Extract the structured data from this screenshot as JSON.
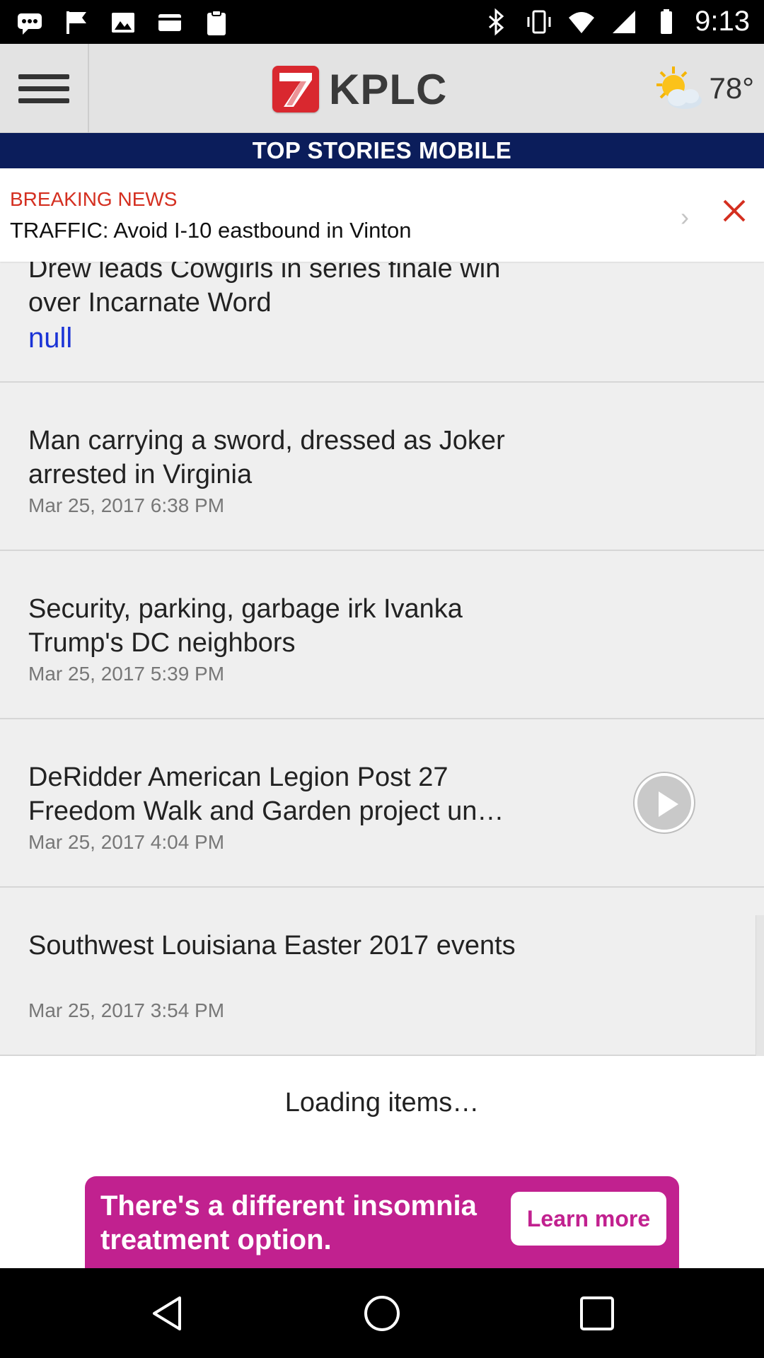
{
  "status_bar": {
    "time": "9:13",
    "left_icons": [
      "chat-icon",
      "flag-icon",
      "image-icon",
      "card-icon",
      "clipboard-icon"
    ],
    "right_icons": [
      "bluetooth-icon",
      "vibrate-icon",
      "wifi-icon",
      "signal-icon",
      "battery-icon"
    ]
  },
  "header": {
    "logo_number": "7",
    "logo_text": "KPLC",
    "weather_icon": "partly-sunny-icon",
    "temperature": "78°"
  },
  "section_title": "TOP STORIES MOBILE",
  "breaking": {
    "label": "BREAKING NEWS",
    "message": "TRAFFIC: Avoid I-10 eastbound in Vinton"
  },
  "stories": [
    {
      "headline": "Drew leads Cowgirls in series finale win over Incarnate Word",
      "date": "null",
      "date_color": "#1a33d6"
    },
    {
      "headline": "Man carrying a sword, dressed as Joker arrested in Virginia",
      "date": "Mar 25, 2017 6:38 PM"
    },
    {
      "headline": "Security, parking, garbage irk Ivanka Trump's DC neighbors",
      "date": "Mar 25, 2017 5:39 PM"
    },
    {
      "headline": "DeRidder American Legion Post 27 Freedom Walk and Garden project un…",
      "date": "Mar 25, 2017 4:04 PM",
      "has_video": true
    },
    {
      "headline": "Southwest Louisiana Easter 2017 events",
      "date": "Mar 25, 2017 3:54 PM"
    }
  ],
  "loading_text": "Loading items…",
  "ad": {
    "text": "There's a different insomnia treatment option.",
    "button": "Learn more",
    "color": "#c1218f"
  },
  "colors": {
    "section_bar": "#0b1d5b",
    "breaking_label": "#d42f20",
    "logo_red": "#d9282f"
  }
}
